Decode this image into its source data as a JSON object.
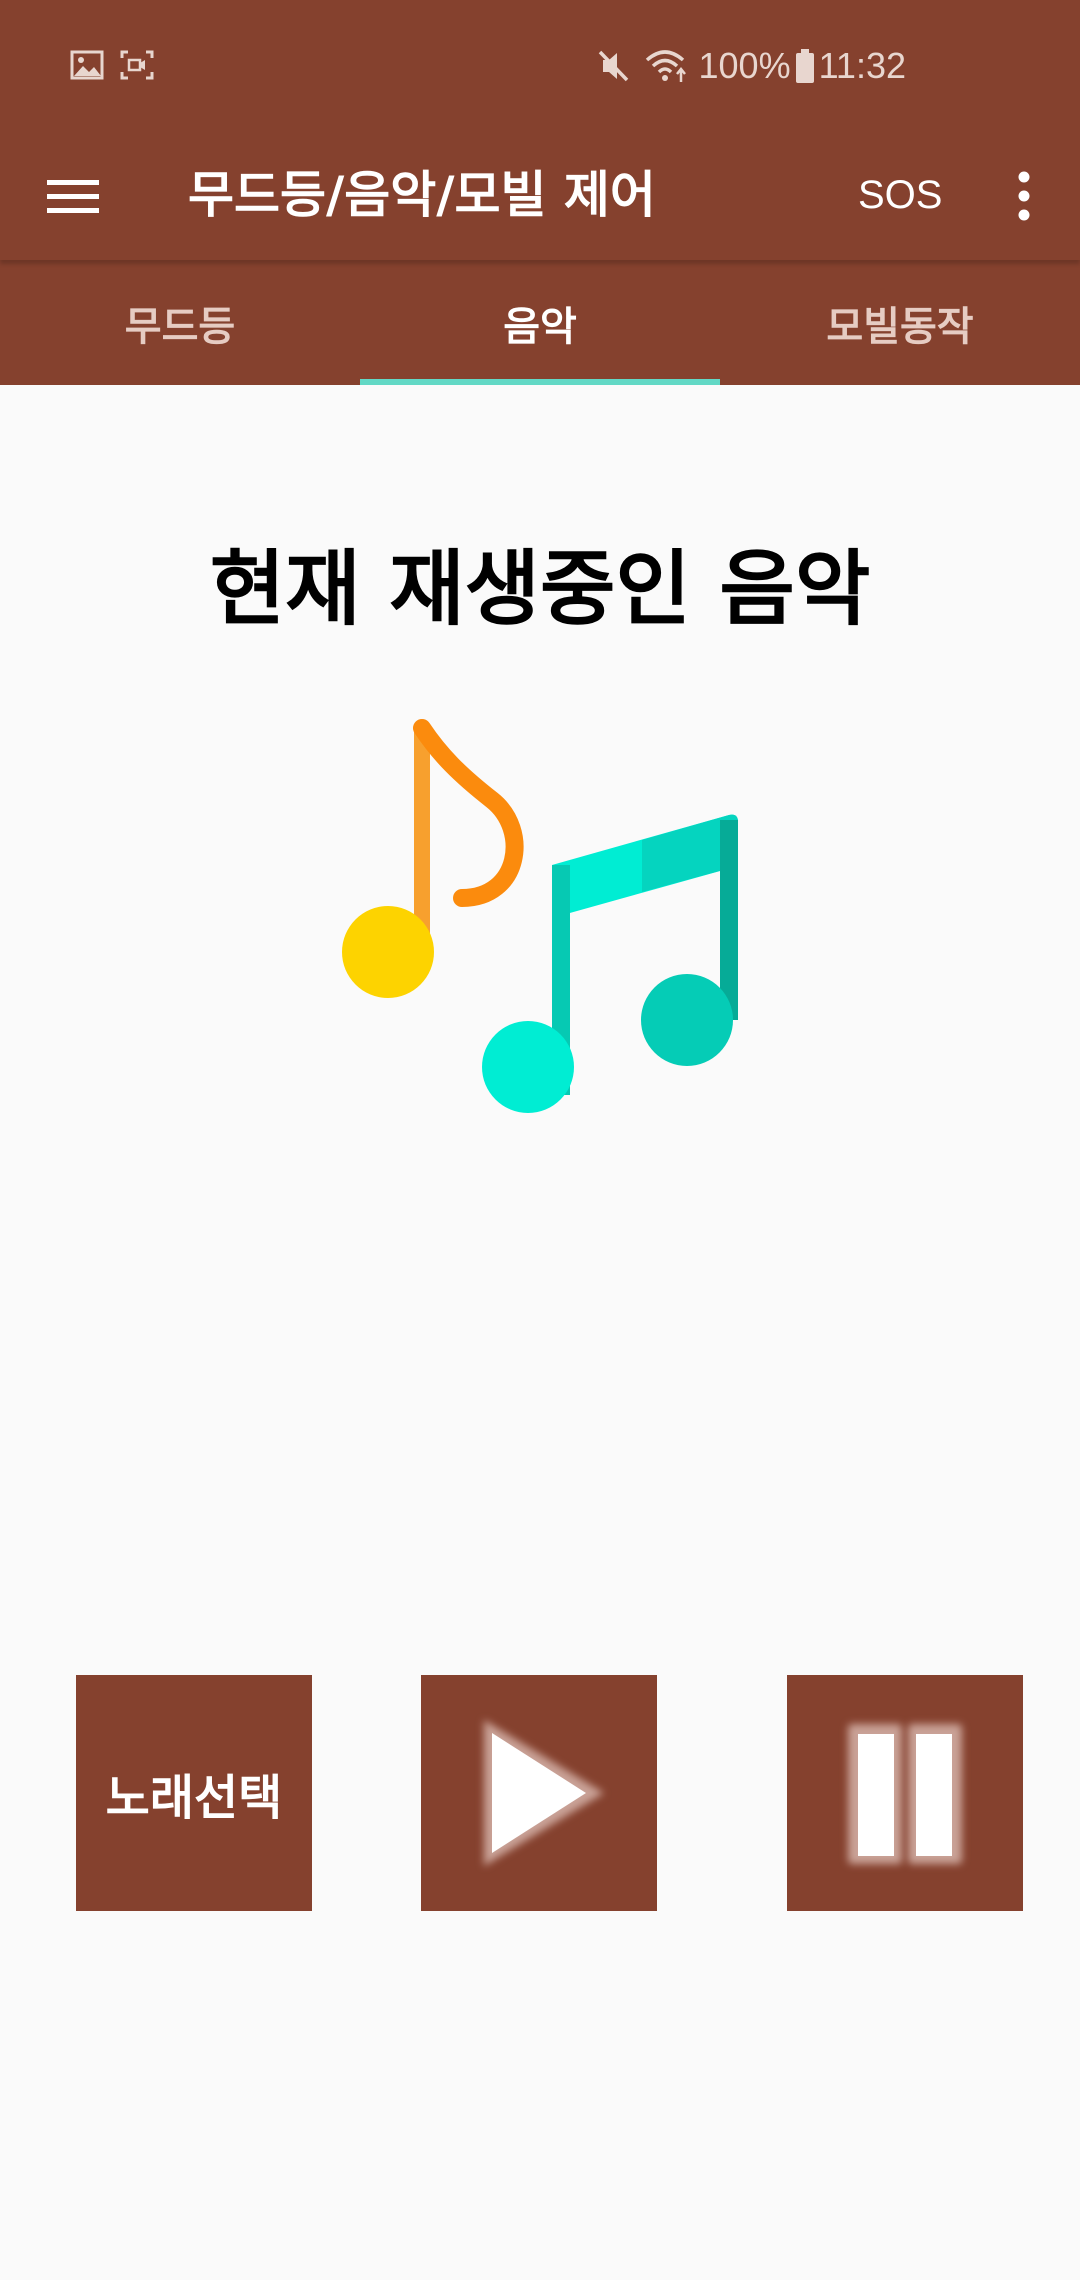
{
  "status_bar": {
    "battery": "100%",
    "time": "11:32",
    "icons": [
      "gallery-icon",
      "screen-record-icon",
      "mute-icon",
      "wifi-icon",
      "battery-icon"
    ]
  },
  "app_bar": {
    "title": "무드등/음악/모빌 제어",
    "sos_label": "SOS",
    "icons": [
      "menu-icon",
      "more-vert-icon"
    ]
  },
  "tabs": [
    {
      "label": "무드등",
      "active": false
    },
    {
      "label": "음악",
      "active": true
    },
    {
      "label": "모빌동작",
      "active": false
    }
  ],
  "main": {
    "heading": "현재 재생중인 음악",
    "art_icon": "music-notes-icon"
  },
  "controls": {
    "select_song_label": "노래선택",
    "play_icon": "play-icon",
    "pause_icon": "pause-icon"
  },
  "colors": {
    "primary": "#85412e",
    "tab_indicator": "#62d8c5",
    "background": "#fafafa"
  }
}
